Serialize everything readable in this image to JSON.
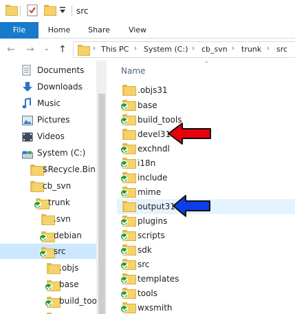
{
  "window": {
    "title": "src"
  },
  "ribbon": {
    "tabs": [
      "File",
      "Home",
      "Share",
      "View"
    ]
  },
  "address": {
    "crumbs": [
      "This PC",
      "System (C:)",
      "cb_svn",
      "trunk",
      "src"
    ]
  },
  "nav": {
    "items": [
      {
        "label": "Documents",
        "icon": "documents-icon"
      },
      {
        "label": "Downloads",
        "icon": "downloads-icon"
      },
      {
        "label": "Music",
        "icon": "music-icon"
      },
      {
        "label": "Pictures",
        "icon": "pictures-icon"
      },
      {
        "label": "Videos",
        "icon": "videos-icon"
      },
      {
        "label": "System (C:)",
        "icon": "drive-icon"
      },
      {
        "label": "$Recycle.Bin",
        "icon": "folder-icon"
      },
      {
        "label": "cb_svn",
        "icon": "folder-icon"
      },
      {
        "label": "trunk",
        "icon": "folder-svn-ok-icon"
      },
      {
        "label": ".svn",
        "icon": "folder-icon"
      },
      {
        "label": "debian",
        "icon": "folder-svn-ok-icon"
      },
      {
        "label": "src",
        "icon": "folder-svn-ok-icon"
      },
      {
        "label": ".objs",
        "icon": "folder-icon"
      },
      {
        "label": "base",
        "icon": "folder-svn-ok-icon"
      },
      {
        "label": "build_tool",
        "icon": "folder-svn-ok-icon"
      },
      {
        "label": "",
        "icon": "folder-icon"
      }
    ]
  },
  "content": {
    "column_header": "Name",
    "files": [
      {
        "name": ".objs31",
        "svn": false
      },
      {
        "name": "base",
        "svn": true
      },
      {
        "name": "build_tools",
        "svn": true
      },
      {
        "name": "devel31",
        "svn": false
      },
      {
        "name": "exchndl",
        "svn": true
      },
      {
        "name": "i18n",
        "svn": true
      },
      {
        "name": "include",
        "svn": true
      },
      {
        "name": "mime",
        "svn": true
      },
      {
        "name": "output31",
        "svn": false
      },
      {
        "name": "plugins",
        "svn": true
      },
      {
        "name": "scripts",
        "svn": true
      },
      {
        "name": "sdk",
        "svn": true
      },
      {
        "name": "src",
        "svn": true
      },
      {
        "name": "templates",
        "svn": true
      },
      {
        "name": "tools",
        "svn": true
      },
      {
        "name": "wxsmith",
        "svn": true
      }
    ]
  },
  "annotations": {
    "red_arrow_color": "#e8000b",
    "blue_arrow_color": "#0a3ee6"
  }
}
